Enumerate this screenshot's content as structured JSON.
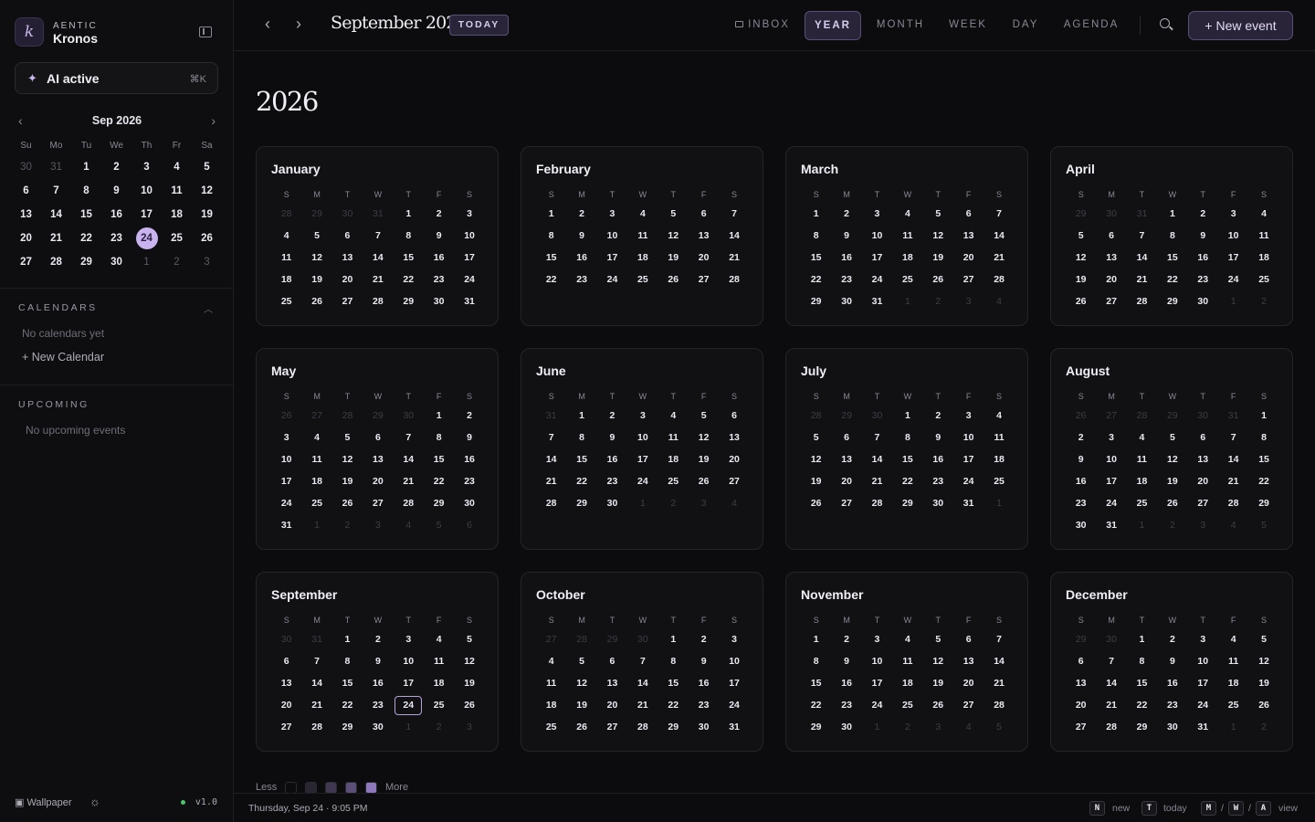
{
  "brand": {
    "small": "AENTIC",
    "name": "Kronos",
    "logo_letter": "k"
  },
  "ai": {
    "label": "AI active",
    "shortcut": "⌘K"
  },
  "mini": {
    "title": "Sep 2026",
    "dow": [
      "Su",
      "Mo",
      "Tu",
      "We",
      "Th",
      "Fr",
      "Sa"
    ],
    "days": [
      [
        "30",
        "out"
      ],
      [
        "31",
        "out"
      ],
      [
        "1",
        ""
      ],
      [
        "2",
        ""
      ],
      [
        "3",
        ""
      ],
      [
        "4",
        ""
      ],
      [
        "5",
        ""
      ],
      [
        "6",
        ""
      ],
      [
        "7",
        ""
      ],
      [
        "8",
        ""
      ],
      [
        "9",
        ""
      ],
      [
        "10",
        ""
      ],
      [
        "11",
        ""
      ],
      [
        "12",
        ""
      ],
      [
        "13",
        ""
      ],
      [
        "14",
        ""
      ],
      [
        "15",
        ""
      ],
      [
        "16",
        ""
      ],
      [
        "17",
        ""
      ],
      [
        "18",
        ""
      ],
      [
        "19",
        ""
      ],
      [
        "20",
        ""
      ],
      [
        "21",
        ""
      ],
      [
        "22",
        ""
      ],
      [
        "23",
        ""
      ],
      [
        "24",
        "today"
      ],
      [
        "25",
        ""
      ],
      [
        "26",
        ""
      ],
      [
        "27",
        ""
      ],
      [
        "28",
        ""
      ],
      [
        "29",
        ""
      ],
      [
        "30",
        ""
      ],
      [
        "1",
        "out"
      ],
      [
        "2",
        "out"
      ],
      [
        "3",
        "out"
      ]
    ]
  },
  "calendars": {
    "title": "CALENDARS",
    "empty": "No calendars yet",
    "new_label": "New Calendar"
  },
  "upcoming": {
    "title": "UPCOMING",
    "empty": "No upcoming events"
  },
  "footer": {
    "wallpaper": "Wallpaper",
    "version": "v1.0"
  },
  "topbar": {
    "period": "September 2026",
    "today": "TODAY",
    "views": [
      {
        "label": "INBOX",
        "active": false
      },
      {
        "label": "YEAR",
        "active": true
      },
      {
        "label": "MONTH",
        "active": false
      },
      {
        "label": "WEEK",
        "active": false
      },
      {
        "label": "DAY",
        "active": false
      },
      {
        "label": "AGENDA",
        "active": false
      }
    ],
    "new_event": "+ New event"
  },
  "year": "2026",
  "dow_short": [
    "S",
    "M",
    "T",
    "W",
    "T",
    "F",
    "S"
  ],
  "months": [
    {
      "name": "January",
      "lead": [
        "28",
        "29",
        "30",
        "31"
      ],
      "days": 31,
      "trail": []
    },
    {
      "name": "February",
      "lead": [],
      "days": 28,
      "trail": []
    },
    {
      "name": "March",
      "lead": [],
      "days": 31,
      "trail": [
        "1",
        "2",
        "3",
        "4"
      ]
    },
    {
      "name": "April",
      "lead": [
        "29",
        "30",
        "31"
      ],
      "days": 30,
      "trail": [
        "1",
        "2"
      ]
    },
    {
      "name": "May",
      "lead": [
        "26",
        "27",
        "28",
        "29",
        "30"
      ],
      "days": 31,
      "trail": [
        "1",
        "2",
        "3",
        "4",
        "5",
        "6"
      ]
    },
    {
      "name": "June",
      "lead": [
        "31"
      ],
      "days": 30,
      "trail": [
        "1",
        "2",
        "3",
        "4"
      ]
    },
    {
      "name": "July",
      "lead": [
        "28",
        "29",
        "30"
      ],
      "days": 31,
      "trail": [
        "1"
      ]
    },
    {
      "name": "August",
      "lead": [
        "26",
        "27",
        "28",
        "29",
        "30",
        "31"
      ],
      "days": 31,
      "trail": [
        "1",
        "2",
        "3",
        "4",
        "5"
      ]
    },
    {
      "name": "September",
      "lead": [
        "30",
        "31"
      ],
      "days": 30,
      "trail": [
        "1",
        "2",
        "3"
      ],
      "today": 24
    },
    {
      "name": "October",
      "lead": [
        "27",
        "28",
        "29",
        "30"
      ],
      "days": 31,
      "trail": []
    },
    {
      "name": "November",
      "lead": [],
      "days": 30,
      "trail": [
        "1",
        "2",
        "3",
        "4",
        "5"
      ]
    },
    {
      "name": "December",
      "lead": [
        "29",
        "30"
      ],
      "days": 31,
      "trail": [
        "1",
        "2"
      ]
    }
  ],
  "legend": {
    "less": "Less",
    "more": "More",
    "colors": [
      "#0c0c0e",
      "#2a2631",
      "#3f3850",
      "#5b4f78",
      "#8e78bb"
    ]
  },
  "status": {
    "time": "Thursday, Sep 24 · 9:05 PM",
    "hints": [
      {
        "keys": [
          "N"
        ],
        "label": "new"
      },
      {
        "keys": [
          "T"
        ],
        "label": "today"
      },
      {
        "keys": [
          "M",
          "W",
          "A"
        ],
        "label": "view"
      }
    ]
  },
  "accent": "#c9b3ee"
}
